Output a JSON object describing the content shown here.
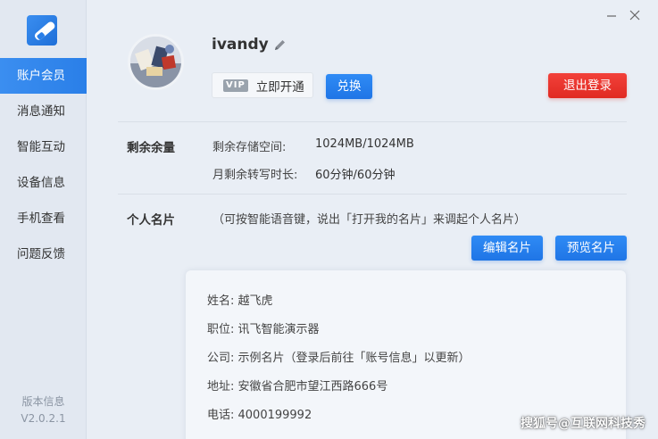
{
  "window": {
    "minimize_icon": "minimize-icon",
    "close_icon": "close-icon"
  },
  "sidebar": {
    "items": [
      {
        "label": "账户会员",
        "active": true
      },
      {
        "label": "消息通知"
      },
      {
        "label": "智能互动"
      },
      {
        "label": "设备信息"
      },
      {
        "label": "手机查看"
      },
      {
        "label": "问题反馈"
      }
    ],
    "version_label": "版本信息",
    "version_number": "V2.0.2.1"
  },
  "profile": {
    "username": "ivandy",
    "vip_badge": "VIP",
    "vip_button": "立即开通",
    "redeem_button": "兑换",
    "logout_button": "退出登录"
  },
  "quota": {
    "title": "剩余余量",
    "storage_label": "剩余存储空间:",
    "storage_value": "1024MB/1024MB",
    "transcribe_label": "月剩余转写时长:",
    "transcribe_value": "60分钟/60分钟"
  },
  "card": {
    "title": "个人名片",
    "hint": "（可按智能语音键，说出「打开我的名片」来调起个人名片）",
    "edit_button": "编辑名片",
    "preview_button": "预览名片",
    "rows": [
      "姓名:  越飞虎",
      "职位:  讯飞智能演示器",
      "公司:  示例名片（登录后前往「账号信息」以更新）",
      "地址:  安徽省合肥市望江西路666号",
      "电话:  4000199992"
    ]
  },
  "watermark": "搜狐号@互联网科技秀",
  "colors": {
    "accent": "#2a7fe8",
    "danger": "#e53028",
    "sidebar_bg": "#e2e8f1"
  }
}
